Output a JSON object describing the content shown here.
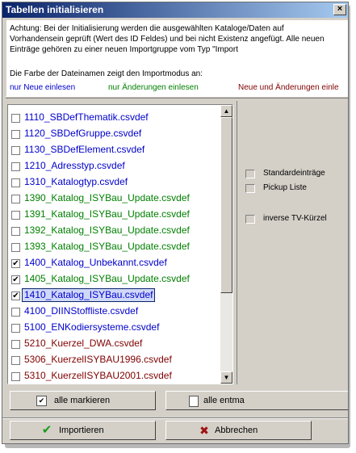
{
  "window": {
    "title": "Tabellen initialisieren",
    "close_glyph": "×"
  },
  "info": {
    "text": "Achtung: Bei der Initialisierung werden die ausgewählten Kataloge/Daten auf Vorhandensein geprüft (Wert des ID Feldes) und bei nicht Existenz angefügt. Alle neuen Einträge gehören zu einer neuen Importgruppe vom Typ \"Import",
    "legend_label": "Die Farbe der Dateinamen zeigt den Importmodus an:",
    "legend": [
      {
        "text": "nur Neue einlesen",
        "color": "#0000cc"
      },
      {
        "text": "nur Änderungen einlesen",
        "color": "#008000"
      },
      {
        "text": "Neue und Änderungen einle",
        "color": "#800000"
      }
    ]
  },
  "files": [
    {
      "label": "1110_SBDefThematik.csvdef",
      "checked": false,
      "mode": "blue"
    },
    {
      "label": "1120_SBDefGruppe.csvdef",
      "checked": false,
      "mode": "blue"
    },
    {
      "label": "1130_SBDefElement.csvdef",
      "checked": false,
      "mode": "blue"
    },
    {
      "label": "1210_Adresstyp.csvdef",
      "checked": false,
      "mode": "blue"
    },
    {
      "label": "1310_Katalogtyp.csvdef",
      "checked": false,
      "mode": "blue"
    },
    {
      "label": "1390_Katalog_ISYBau_Update.csvdef",
      "checked": false,
      "mode": "green"
    },
    {
      "label": "1391_Katalog_ISYBau_Update.csvdef",
      "checked": false,
      "mode": "green"
    },
    {
      "label": "1392_Katalog_ISYBau_Update.csvdef",
      "checked": false,
      "mode": "green"
    },
    {
      "label": "1393_Katalog_ISYBau_Update.csvdef",
      "checked": false,
      "mode": "green"
    },
    {
      "label": "1400_Katalog_Unbekannt.csvdef",
      "checked": true,
      "mode": "blue"
    },
    {
      "label": "1405_Katalog_ISYBau_Update.csvdef",
      "checked": true,
      "mode": "green"
    },
    {
      "label": "1410_Katalog_ISYBau.csvdef",
      "checked": true,
      "mode": "blue",
      "selected": true
    },
    {
      "label": "4100_DIINStoffliste.csvdef",
      "checked": false,
      "mode": "blue"
    },
    {
      "label": "5100_ENKodiersysteme.csvdef",
      "checked": false,
      "mode": "blue"
    },
    {
      "label": "5210_Kuerzel_DWA.csvdef",
      "checked": false,
      "mode": "red"
    },
    {
      "label": "5306_KuerzelISYBAU1996.csvdef",
      "checked": false,
      "mode": "red"
    },
    {
      "label": "5310_KuerzelISYBAU2001.csvdef",
      "checked": false,
      "mode": "red"
    }
  ],
  "scrollbar": {
    "up_glyph": "▲",
    "down_glyph": "▼"
  },
  "options": [
    {
      "label": "Standardeinträge",
      "checked": false
    },
    {
      "label": "Pickup Liste",
      "checked": false
    },
    {
      "label": "inverse TV-Kürzel",
      "checked": false
    }
  ],
  "buttons": {
    "mark_all": "alle markieren",
    "unmark_all": "alle entma",
    "import": "Importieren",
    "cancel": "Abbrechen",
    "check_glyph": "✔",
    "cancel_glyph": "✖"
  },
  "colors": {
    "titlebar_start": "#0a246a",
    "titlebar_end": "#a6caf0",
    "import_check": "#1a9a1a",
    "cancel_x": "#a01010"
  }
}
